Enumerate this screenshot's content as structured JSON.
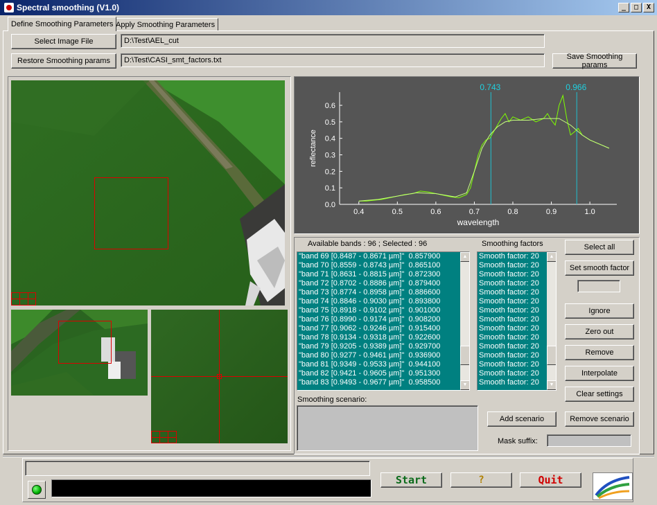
{
  "window": {
    "title": "Spectral smoothing  (V1.0)",
    "min_label": "_",
    "max_label": "□",
    "close_label": "X"
  },
  "tabs": [
    {
      "label": "Define Smoothing Parameters"
    },
    {
      "label": "Apply Smoothing Parameters"
    }
  ],
  "files": {
    "select_image_label": "Select Image File",
    "image_path": "D:\\Test\\AEL_cut",
    "restore_label": "Restore Smoothing params",
    "params_path": "D:\\Test\\CASI_smt_factors.txt",
    "save_label": "Save Smoothing params"
  },
  "chart_data": {
    "type": "line",
    "xlabel": "wavelength",
    "ylabel": "reflectance",
    "xlim": [
      0.35,
      1.07
    ],
    "ylim": [
      0.0,
      0.68
    ],
    "xticks": [
      "0.4",
      "0.5",
      "0.6",
      "0.7",
      "0.8",
      "0.9",
      "1.0"
    ],
    "yticks": [
      "0.0",
      "0.1",
      "0.2",
      "0.3",
      "0.4",
      "0.5",
      "0.6"
    ],
    "markers": [
      {
        "x": 0.743,
        "label": "0.743"
      },
      {
        "x": 0.966,
        "label": "0.966"
      }
    ],
    "series": [
      {
        "color": "#7fff00",
        "x": [
          0.4,
          0.42,
          0.44,
          0.46,
          0.48,
          0.5,
          0.52,
          0.54,
          0.56,
          0.58,
          0.6,
          0.62,
          0.64,
          0.66,
          0.68,
          0.69,
          0.7,
          0.71,
          0.72,
          0.73,
          0.74,
          0.75,
          0.76,
          0.77,
          0.78,
          0.79,
          0.8,
          0.82,
          0.84,
          0.86,
          0.88,
          0.89,
          0.9,
          0.91,
          0.92,
          0.93,
          0.94,
          0.95,
          0.96,
          0.97,
          0.98,
          1.0,
          1.02,
          1.04,
          1.05
        ],
        "y": [
          0.02,
          0.02,
          0.025,
          0.03,
          0.04,
          0.05,
          0.06,
          0.065,
          0.08,
          0.075,
          0.065,
          0.055,
          0.045,
          0.04,
          0.06,
          0.1,
          0.2,
          0.3,
          0.36,
          0.39,
          0.4,
          0.44,
          0.48,
          0.52,
          0.55,
          0.5,
          0.53,
          0.51,
          0.53,
          0.5,
          0.52,
          0.55,
          0.51,
          0.48,
          0.6,
          0.66,
          0.52,
          0.42,
          0.44,
          0.46,
          0.42,
          0.39,
          0.37,
          0.35,
          0.34
        ]
      },
      {
        "color": "#c8ff80",
        "x": [
          0.4,
          0.45,
          0.5,
          0.55,
          0.6,
          0.65,
          0.68,
          0.7,
          0.72,
          0.74,
          0.76,
          0.78,
          0.8,
          0.84,
          0.88,
          0.92,
          0.95,
          0.98,
          1.0,
          1.03,
          1.05
        ],
        "y": [
          0.02,
          0.03,
          0.05,
          0.07,
          0.065,
          0.045,
          0.07,
          0.2,
          0.34,
          0.42,
          0.47,
          0.5,
          0.51,
          0.51,
          0.52,
          0.52,
          0.48,
          0.42,
          0.39,
          0.36,
          0.34
        ]
      }
    ]
  },
  "bands": {
    "header": "Available bands : 96 ; Selected : 96",
    "rows": [
      "\"band 69 [0.8487 - 0.8671 µm]\"  0.857900",
      "\"band 70 [0.8559 - 0.8743 µm]\"  0.865100",
      "\"band 71 [0.8631 - 0.8815 µm]\"  0.872300",
      "\"band 72 [0.8702 - 0.8886 µm]\"  0.879400",
      "\"band 73 [0.8774 - 0.8958 µm]\"  0.886600",
      "\"band 74 [0.8846 - 0.9030 µm]\"  0.893800",
      "\"band 75 [0.8918 - 0.9102 µm]\"  0.901000",
      "\"band 76 [0.8990 - 0.9174 µm]\"  0.908200",
      "\"band 77 [0.9062 - 0.9246 µm]\"  0.915400",
      "\"band 78 [0.9134 - 0.9318 µm]\"  0.922600",
      "\"band 79 [0.9205 - 0.9389 µm]\"  0.929700",
      "\"band 80 [0.9277 - 0.9461 µm]\"  0.936900",
      "\"band 81 [0.9349 - 0.9533 µm]\"  0.944100",
      "\"band 82 [0.9421 - 0.9605 µm]\"  0.951300",
      "\"band 83 [0.9493 - 0.9677 µm]\"  0.958500"
    ]
  },
  "smoothing": {
    "header": "Smoothing factors",
    "rows": [
      "Smooth factor: 20",
      "Smooth factor: 20",
      "Smooth factor: 20",
      "Smooth factor: 20",
      "Smooth factor: 20",
      "Smooth factor: 20",
      "Smooth factor: 20",
      "Smooth factor: 20",
      "Smooth factor: 20",
      "Smooth factor: 20",
      "Smooth factor: 20",
      "Smooth factor: 20",
      "Smooth factor: 20",
      "Smooth factor: 20",
      "Smooth factor: 20"
    ]
  },
  "actions": {
    "select_all": "Select all",
    "set_smooth": "Set smooth factor",
    "ignore": "Ignore",
    "zero_out": "Zero out",
    "remove": "Remove",
    "interpolate": "Interpolate",
    "clear_settings": "Clear settings",
    "add_scenario": "Add scenario",
    "remove_scenario": "Remove scenario",
    "scenario_label": "Smoothing scenario:",
    "mask_label": "Mask suffix:"
  },
  "footer": {
    "start": "Start",
    "help": "?",
    "quit": "Quit"
  }
}
